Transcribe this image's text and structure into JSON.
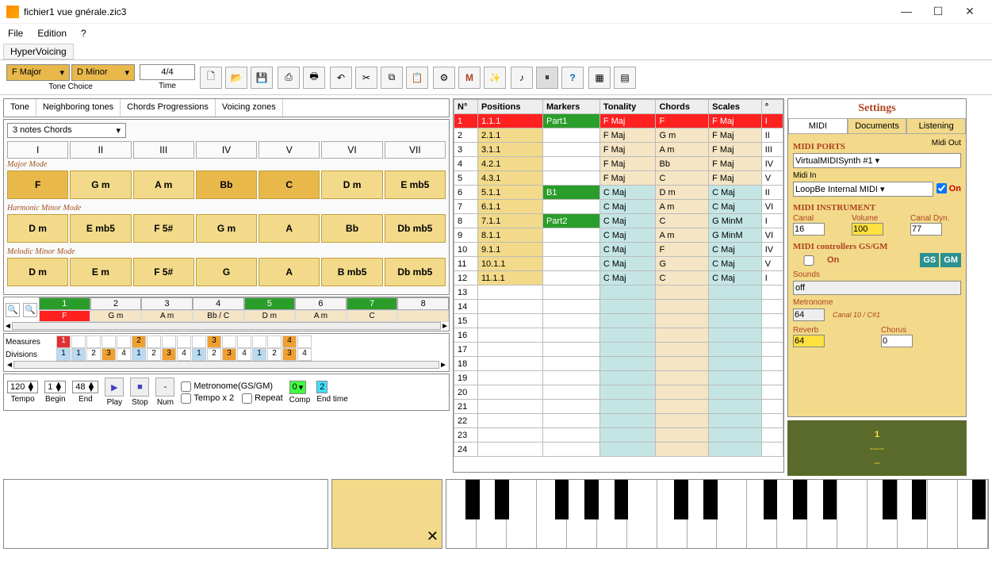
{
  "window": {
    "title": "fichier1 vue gnérale.zic3"
  },
  "menu": {
    "file": "File",
    "edition": "Edition",
    "help": "?"
  },
  "maintab": "HyperVoicing",
  "tonechoice": {
    "major": "F Major",
    "minor": "D Minor",
    "label": "Tone Choice"
  },
  "time": {
    "sig": "4/4",
    "label": "Time"
  },
  "subtabs": {
    "tone": "Tone",
    "neighboring": "Neighboring tones",
    "prog": "Chords Progressions",
    "zones": "Voicing zones"
  },
  "chordsel": "3 notes Chords",
  "degrees": [
    "I",
    "II",
    "III",
    "IV",
    "V",
    "VI",
    "VII"
  ],
  "modes": {
    "major": {
      "label": "Major Mode",
      "chords": [
        "F",
        "G m",
        "A m",
        "Bb",
        "C",
        "D m",
        "E mb5"
      ]
    },
    "harmonic": {
      "label": "Harmonic Minor Mode",
      "chords": [
        "D m",
        "E mb5",
        "F 5#",
        "G m",
        "A",
        "Bb",
        "Db mb5"
      ]
    },
    "melodic": {
      "label": "Melodic Minor Mode",
      "chords": [
        "D m",
        "E m",
        "F 5#",
        "G",
        "A",
        "B mb5",
        "Db mb5"
      ]
    }
  },
  "seq": {
    "nums": [
      "1",
      "2",
      "3",
      "4",
      "5",
      "6",
      "7",
      "8"
    ],
    "chords": [
      "F",
      "G m",
      "A m",
      "Bb / C",
      "D m",
      "A m",
      "C",
      ""
    ]
  },
  "measures": {
    "label": "Measures",
    "vals": [
      "1",
      "",
      "",
      "",
      "",
      "2",
      "",
      "",
      "",
      "",
      "3",
      "",
      "",
      "",
      "",
      "4",
      ""
    ]
  },
  "divisions": {
    "label": "Divisions",
    "vals": [
      "1",
      "1",
      "2",
      "3",
      "4",
      "1",
      "2",
      "3",
      "4",
      "1",
      "2",
      "3",
      "4",
      "1",
      "2",
      "3",
      "4"
    ]
  },
  "transport": {
    "tempo": {
      "val": "120",
      "label": "Tempo"
    },
    "begin": {
      "val": "1",
      "label": "Begin"
    },
    "end": {
      "val": "48",
      "label": "End"
    },
    "play": "Play",
    "stop": "Stop",
    "num": "Num",
    "metronome": "Metronome(GS/GM)",
    "tempox2": "Tempo x 2",
    "repeat": "Repeat",
    "comp": {
      "val": "0",
      "label": "Comp"
    },
    "endtime": {
      "val": "2",
      "label": "End time"
    }
  },
  "grid": {
    "headers": [
      "N°",
      "Positions",
      "Markers",
      "Tonality",
      "Chords",
      "Scales",
      "°"
    ],
    "rows": [
      {
        "n": "1",
        "pos": "1.1.1",
        "mk": "Part1",
        "ton": "F Maj",
        "ch": "F",
        "sc": "F Maj",
        "deg": "I",
        "red": true
      },
      {
        "n": "2",
        "pos": "2.1.1",
        "mk": "",
        "ton": "F Maj",
        "ch": "G m",
        "sc": "F Maj",
        "deg": "II"
      },
      {
        "n": "3",
        "pos": "3.1.1",
        "mk": "",
        "ton": "F Maj",
        "ch": "A m",
        "sc": "F Maj",
        "deg": "III"
      },
      {
        "n": "4",
        "pos": "4.2.1",
        "mk": "",
        "ton": "F Maj",
        "ch": "Bb",
        "sc": "F Maj",
        "deg": "IV"
      },
      {
        "n": "5",
        "pos": "4.3.1",
        "mk": "",
        "ton": "F Maj",
        "ch": "C",
        "sc": "F Maj",
        "deg": "V"
      },
      {
        "n": "6",
        "pos": "5.1.1",
        "mk": "B1",
        "ton": "C Maj",
        "ch": "D m",
        "sc": "C Maj",
        "deg": "II",
        "cyan": true
      },
      {
        "n": "7",
        "pos": "6.1.1",
        "mk": "",
        "ton": "C Maj",
        "ch": "A m",
        "sc": "C Maj",
        "deg": "VI",
        "cyan": true
      },
      {
        "n": "8",
        "pos": "7.1.1",
        "mk": "Part2",
        "ton": "C Maj",
        "ch": "C",
        "sc": "G MinM",
        "deg": "I",
        "cyan": true
      },
      {
        "n": "9",
        "pos": "8.1.1",
        "mk": "",
        "ton": "C Maj",
        "ch": "A m",
        "sc": "G MinM",
        "deg": "VI",
        "cyan": true
      },
      {
        "n": "10",
        "pos": "9.1.1",
        "mk": "",
        "ton": "C Maj",
        "ch": "F",
        "sc": "C Maj",
        "deg": "IV",
        "cyan": true
      },
      {
        "n": "11",
        "pos": "10.1.1",
        "mk": "",
        "ton": "C Maj",
        "ch": "G",
        "sc": "C Maj",
        "deg": "V",
        "cyan": true
      },
      {
        "n": "12",
        "pos": "11.1.1",
        "mk": "",
        "ton": "C Maj",
        "ch": "C",
        "sc": "C Maj",
        "deg": "I",
        "cyan": true
      }
    ],
    "empties": [
      "13",
      "14",
      "15",
      "16",
      "17",
      "18",
      "19",
      "20",
      "21",
      "22",
      "23",
      "24"
    ]
  },
  "settings": {
    "title": "Settings",
    "tabs": {
      "midi": "MIDI",
      "docs": "Documents",
      "listen": "Listening"
    },
    "ports": {
      "label": "MIDI PORTS",
      "out_label": "Midi Out",
      "out": "VirtualMIDISynth #1",
      "in_label": "Midi In",
      "in": "LoopBe Internal MIDI",
      "on": "On"
    },
    "instrument": {
      "label": "MIDI INSTRUMENT",
      "canal_label": "Canal",
      "canal": "16",
      "volume_label": "Volume",
      "volume": "100",
      "dyn_label": "Canal Dyn.",
      "dyn": "77"
    },
    "controllers": {
      "label": "MIDI controllers GS/GM",
      "on": "On",
      "gs": "GS",
      "gm": "GM",
      "sounds_label": "Sounds",
      "sounds": "off",
      "metronome_label": "Metronome",
      "metronome": "64",
      "metronome_note": "Canal 10 / C#1",
      "reverb_label": "Reverb",
      "reverb": "64",
      "chorus_label": "Chorus",
      "chorus": "0"
    },
    "status": {
      "line1": "1",
      "line2": "-----",
      "line3": "--"
    }
  },
  "close_x": "✕"
}
